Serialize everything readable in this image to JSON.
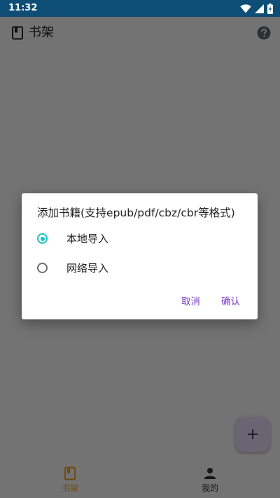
{
  "status_bar": {
    "time": "11:32",
    "icons": [
      "wifi-icon",
      "signal-icon",
      "battery-icon"
    ]
  },
  "app_bar": {
    "title": "书架",
    "icons": [
      "book-icon",
      "help-icon"
    ]
  },
  "dialog": {
    "title": "添加书籍(支持epub/pdf/cbz/cbr等格式)",
    "options": [
      {
        "label": "本地导入",
        "checked": true
      },
      {
        "label": "网络导入",
        "checked": false
      }
    ],
    "cancel_label": "取消",
    "confirm_label": "确认"
  },
  "fab": {
    "icon": "plus-icon"
  },
  "bottom_nav": {
    "items": [
      {
        "label": "书架",
        "icon": "book-icon",
        "active": true
      },
      {
        "label": "我的",
        "icon": "person-icon",
        "active": false
      }
    ]
  },
  "colors": {
    "status_bar": "#0d4d76",
    "accent_radio": "#19c3c3",
    "dialog_button": "#7b3fc4",
    "nav_active": "#f5a623",
    "fab_background": "#ecdffd"
  }
}
